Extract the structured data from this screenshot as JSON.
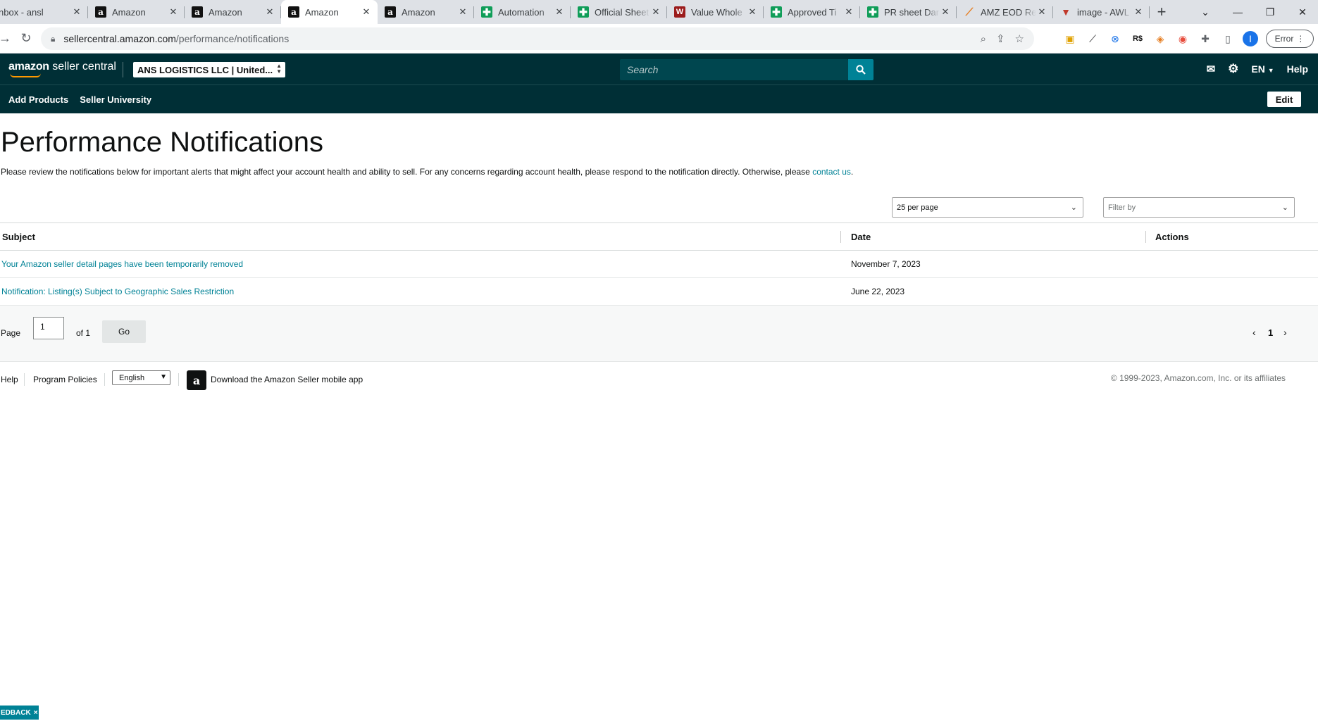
{
  "browser": {
    "tabs": [
      {
        "title": "nbox - ansl",
        "icon": "gmail-icon"
      },
      {
        "title": "Amazon",
        "icon": "amazon-icon"
      },
      {
        "title": "Amazon",
        "icon": "amazon-icon"
      },
      {
        "title": "Amazon",
        "icon": "amazon-icon",
        "active": true
      },
      {
        "title": "Amazon",
        "icon": "amazon-icon"
      },
      {
        "title": "Automation",
        "icon": "sheets-icon"
      },
      {
        "title": "Official Sheet",
        "icon": "sheets-icon"
      },
      {
        "title": "Value Whole",
        "icon": "vw-icon"
      },
      {
        "title": "Approved Ti",
        "icon": "sheets-icon"
      },
      {
        "title": "PR sheet Dar",
        "icon": "sheets-icon"
      },
      {
        "title": "AMZ EOD Re",
        "icon": "amz-eod-icon"
      },
      {
        "title": "image - AWL",
        "icon": "image-icon"
      }
    ],
    "url_host": "sellercentral.amazon.com",
    "url_path": "/performance/notifications",
    "profile_initial": "I",
    "error_label": "Error"
  },
  "header": {
    "logo_brand": "amazon",
    "logo_product": "seller central",
    "merchant": "ANS LOGISTICS LLC | United...",
    "search_placeholder": "Search",
    "language": "EN",
    "help": "Help"
  },
  "nav": {
    "items": [
      "Add Products",
      "Seller University"
    ],
    "edit": "Edit"
  },
  "page": {
    "title": "Performance Notifications",
    "intro_text": "Please review the notifications below for important alerts that might affect your account health and ability to sell. For any concerns regarding account health, please respond to the notification directly. Otherwise, please ",
    "intro_link": "contact us",
    "intro_end": "."
  },
  "controls": {
    "per_page": "25 per page",
    "filter_placeholder": "Filter by"
  },
  "table": {
    "headers": {
      "subject": "Subject",
      "date": "Date",
      "actions": "Actions"
    },
    "rows": [
      {
        "subject": "Your Amazon seller detail pages have been temporarily removed",
        "date": "November 7, 2023"
      },
      {
        "subject": "Notification: Listing(s) Subject to Geographic Sales Restriction",
        "date": "June 22, 2023"
      }
    ]
  },
  "pager": {
    "page_label": "Page",
    "page_value": "1",
    "of_label": "of 1",
    "go": "Go",
    "current": "1"
  },
  "footer": {
    "help": "Help",
    "policies": "Program Policies",
    "language": "English",
    "app_text": "Download the Amazon Seller mobile app",
    "copyright": "© 1999-2023, Amazon.com, Inc. or its affiliates"
  },
  "feedback": {
    "label": "EDBACK",
    "close": "×"
  }
}
